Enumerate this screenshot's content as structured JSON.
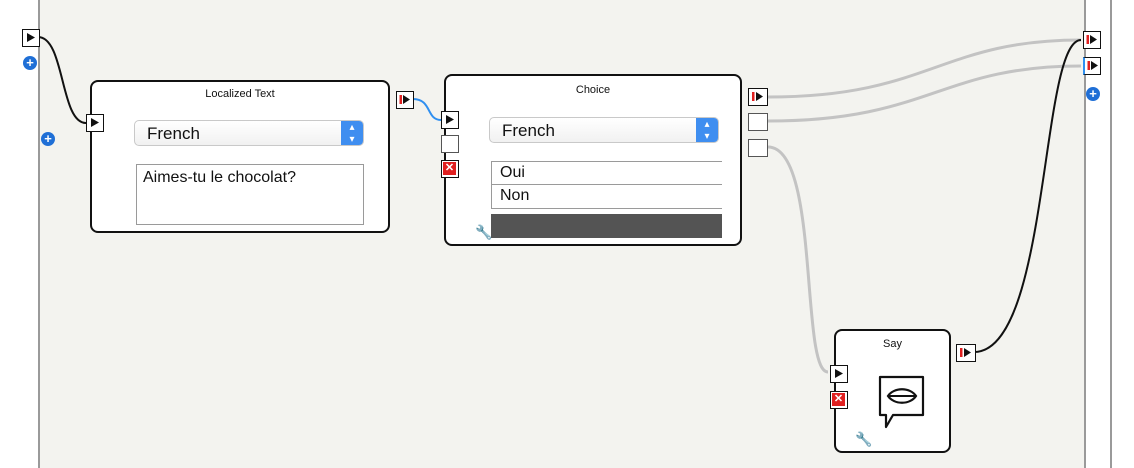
{
  "localized_text_box": {
    "title": "Localized Text",
    "language": "French",
    "text": "Aimes-tu le chocolat?"
  },
  "choice_box": {
    "title": "Choice",
    "language": "French",
    "options": [
      "Oui",
      "Non"
    ]
  },
  "say_box": {
    "title": "Say"
  },
  "colors": {
    "canvas_background": "#f3f3ef",
    "link_black": "#111111",
    "link_gray": "#c3c3c3",
    "link_blue": "#2f8ff0",
    "accent_blue": "#1f6fd6",
    "input_stop_red": "#e02020"
  },
  "icons": {
    "plus": "+",
    "stop": "✕",
    "wrench": "🔧"
  }
}
